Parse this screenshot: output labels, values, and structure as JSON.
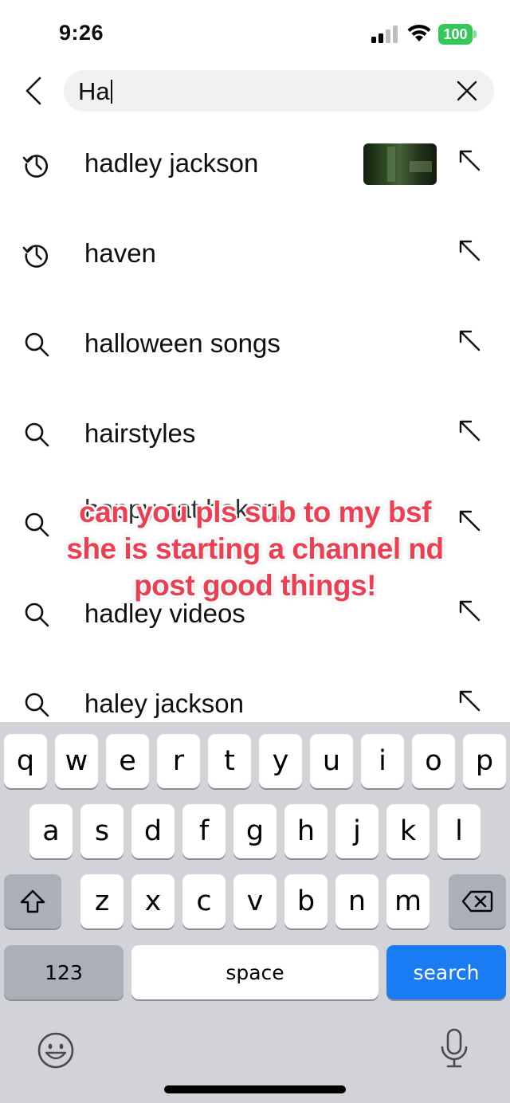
{
  "status_bar": {
    "time": "9:26",
    "battery": "100",
    "battery_color": "#34c759"
  },
  "search": {
    "query": "Ha",
    "back_icon": "chevron-left-icon",
    "clear_icon": "close-icon"
  },
  "suggestions": [
    {
      "label": "hadley jackson",
      "icon": "history-icon",
      "has_thumbnail": true
    },
    {
      "label": "haven",
      "icon": "history-icon",
      "has_thumbnail": false
    },
    {
      "label": "halloween songs",
      "icon": "search-icon",
      "has_thumbnail": false
    },
    {
      "label": "hairstyles",
      "icon": "search-icon",
      "has_thumbnail": false
    },
    {
      "label": "happy cat bakery",
      "icon": "search-icon",
      "has_thumbnail": false
    },
    {
      "label": "hadley videos",
      "icon": "search-icon",
      "has_thumbnail": false
    },
    {
      "label": "haley jackson",
      "icon": "search-icon",
      "has_thumbnail": false
    }
  ],
  "caption": {
    "lines": [
      "can you pls sub to my bsf",
      "she is starting a channel nd",
      "post good things!"
    ],
    "color": "#ef3e52"
  },
  "keyboard": {
    "row1": [
      "q",
      "w",
      "e",
      "r",
      "t",
      "y",
      "u",
      "i",
      "o",
      "p"
    ],
    "row2": [
      "a",
      "s",
      "d",
      "f",
      "g",
      "h",
      "j",
      "k",
      "l"
    ],
    "row3": [
      "z",
      "x",
      "c",
      "v",
      "b",
      "n",
      "m"
    ],
    "numbers_label": "123",
    "space_label": "space",
    "search_label": "search",
    "search_color": "#1a7cf5",
    "shift_icon": "shift-icon",
    "delete_icon": "backspace-icon",
    "emoji_icon": "emoji-icon",
    "mic_icon": "microphone-icon"
  }
}
